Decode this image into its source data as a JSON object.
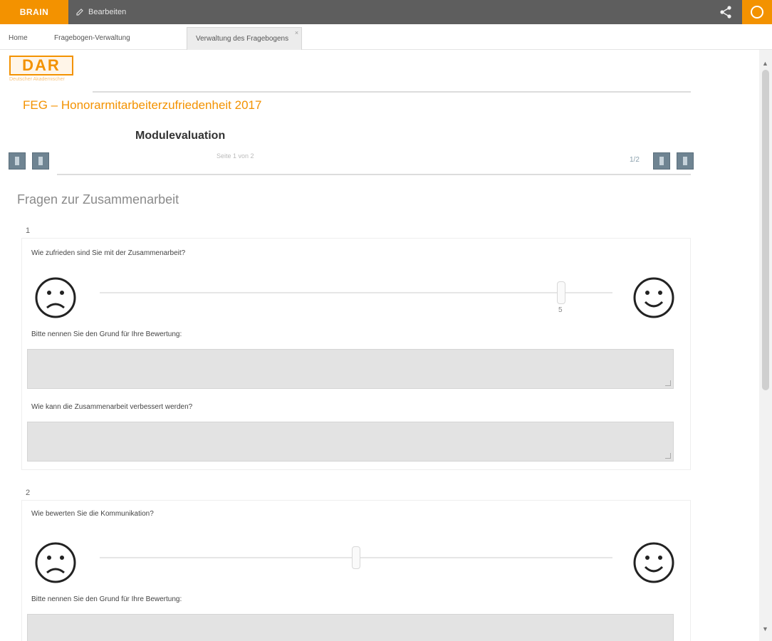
{
  "topbar": {
    "brand": "BRAIN",
    "edit_label": "Bearbeiten",
    "share_icon": "share-icon",
    "user_icon": "user-icon"
  },
  "tabs": [
    {
      "label": "Home"
    },
    {
      "label": "Fragebogen-Verwaltung"
    },
    {
      "label": "Verwaltung des Fragebogens",
      "close": "×"
    }
  ],
  "header": {
    "logo": "DAR",
    "logo_sub": "Deutscher Akademischer",
    "survey_title": "FEG – Honorarmitarbeiterzufriedenheit 2017",
    "section_title": "Modulevaluation",
    "section_sub": "Seite 1 von 2",
    "page_count": "1/2"
  },
  "intro": "Fragen zur Zusammenarbeit",
  "questions": [
    {
      "number": "1",
      "label": "Wie zufrieden sind Sie mit der Zusammenarbeit?",
      "slider_value": 0.9,
      "slider_value_text": "5",
      "reason_label": "Bitte nennen Sie den Grund für Ihre Bewertung:",
      "improve_label": "Wie kann die Zusammenarbeit verbessert werden?"
    },
    {
      "number": "2",
      "label": "Wie bewerten Sie die Kommunikation?",
      "slider_value": 0.5,
      "reason_label": "Bitte nennen Sie den Grund für Ihre Bewertung:"
    }
  ],
  "colors": {
    "accent": "#f39200",
    "topbar": "#5e5e5e",
    "nav_button": "#6f8492",
    "textarea": "#e3e3e3"
  }
}
